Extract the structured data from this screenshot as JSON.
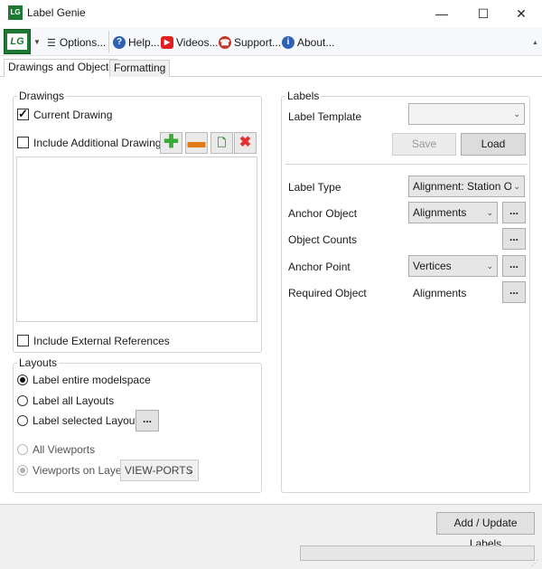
{
  "window": {
    "title": "Label Genie",
    "icon_text": "LG",
    "minimize": "—",
    "maximize": "☐",
    "close": "✕"
  },
  "toolbar": {
    "logo_text": "LG",
    "options": "Options...",
    "help": "Help...",
    "videos": "Videos...",
    "support": "Support...",
    "about": "About..."
  },
  "tabs": [
    {
      "label": "Drawings and Objects",
      "active": true
    },
    {
      "label": "Formatting",
      "active": false
    }
  ],
  "drawings": {
    "title": "Drawings",
    "current_drawing": "Current Drawing",
    "current_drawing_checked": true,
    "include_additional": "Include Additional Drawings",
    "include_additional_checked": false,
    "include_external": "Include External References",
    "include_external_checked": false
  },
  "layouts": {
    "title": "Layouts",
    "label_entire_modelspace": "Label entire modelspace",
    "label_all_layouts": "Label all Layouts",
    "label_selected_layouts": "Label selected Layouts",
    "all_viewports": "All Viewports",
    "viewports_on_layer": "Viewports on Layer",
    "viewport_layer_value": "VIEW-PORTS",
    "ellipsis": "..."
  },
  "labels": {
    "title": "Labels",
    "label_template": "Label Template",
    "label_template_value": "",
    "save": "Save",
    "load": "Load",
    "label_type": "Label Type",
    "label_type_value": "Alignment: Station Of",
    "anchor_object": "Anchor Object",
    "anchor_object_value": "Alignments",
    "object_counts": "Object Counts",
    "anchor_point": "Anchor Point",
    "anchor_point_value": "Vertices",
    "required_object": "Required Object",
    "required_object_value": "Alignments",
    "ellipsis": "..."
  },
  "footer": {
    "add_update": "Add / Update Labels",
    "progress": 0
  },
  "colors": {
    "brand": "#1e7a33",
    "progress": "#06b025"
  },
  "icons": [
    "app-logo-icon",
    "options-list-icon",
    "help-icon",
    "videos-play-icon",
    "support-headset-icon",
    "about-info-icon",
    "add-plus-icon",
    "remove-minus-icon",
    "file-icon",
    "delete-x-icon"
  ]
}
